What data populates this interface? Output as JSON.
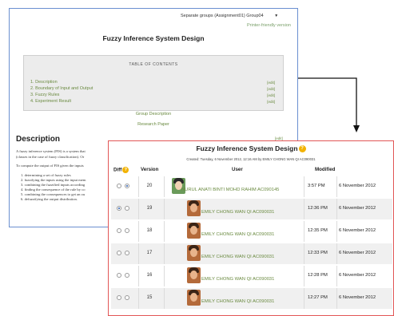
{
  "back": {
    "group_select": "Separate groups (Assignment01) Group04",
    "printer_link": "Printer-friendly version",
    "title": "Fuzzy Inference System Design",
    "toc": {
      "title": "TABLE OF CONTENTS",
      "items": [
        "1. Description",
        "2. Boundary of Input and Output",
        "3. Fuzzy Rules",
        "4. Experiment Result"
      ],
      "edit": "[edit]"
    },
    "links": [
      "Group Description",
      "Research Paper"
    ],
    "description": {
      "heading": "Description",
      "edit": "[edit]",
      "para1": "A fuzzy inference system (FIS) is a system that",
      "para2": "(classes in the case of fuzzy classification). Or",
      "para3": "To compute the output of FIS given the inputs",
      "list": [
        "1.  determining a set of fuzzy rules",
        "2.  fuzzifying the inputs using the input mem",
        "3.  combining the fuzzified inputs according",
        "4.  finding the consequence of the rule by co",
        "5.  combining the consequences to get an ou",
        "6.  defuzzifying the output distribution."
      ]
    }
  },
  "front": {
    "title": "Fuzzy Inference System Design",
    "created": "Created: Tuesday, 6 November 2012, 12:16 AM by EMILY CHONG WAN QI AC090031",
    "headers": {
      "diff": "Diff",
      "version": "Version",
      "user": "User",
      "modified": "Modified"
    },
    "rows": [
      {
        "version": "20",
        "user": "NURUL ANATI BINTI MOHD RAHIM AC090145",
        "time": "3:57 PM",
        "date": "6 November 2012",
        "left_on": false,
        "right_on": true
      },
      {
        "version": "19",
        "user": "EMILY CHONG WAN QI AC090031",
        "time": "12:36 PM",
        "date": "6 November 2012",
        "left_on": true,
        "right_on": false
      },
      {
        "version": "18",
        "user": "EMILY CHONG WAN QI AC090031",
        "time": "12:35 PM",
        "date": "6 November 2012",
        "left_on": false,
        "right_on": false
      },
      {
        "version": "17",
        "user": "EMILY CHONG WAN QI AC090031",
        "time": "12:33 PM",
        "date": "6 November 2012",
        "left_on": false,
        "right_on": false
      },
      {
        "version": "16",
        "user": "EMILY CHONG WAN QI AC090031",
        "time": "12:28 PM",
        "date": "6 November 2012",
        "left_on": false,
        "right_on": false
      },
      {
        "version": "15",
        "user": "EMILY CHONG WAN QI AC090031",
        "time": "12:27 PM",
        "date": "6 November 2012",
        "left_on": false,
        "right_on": false
      }
    ]
  },
  "colors": {
    "link": "#6a8a40",
    "back_border": "#6a8fd0",
    "front_border": "#e25656",
    "help_icon": "#f2b200"
  }
}
